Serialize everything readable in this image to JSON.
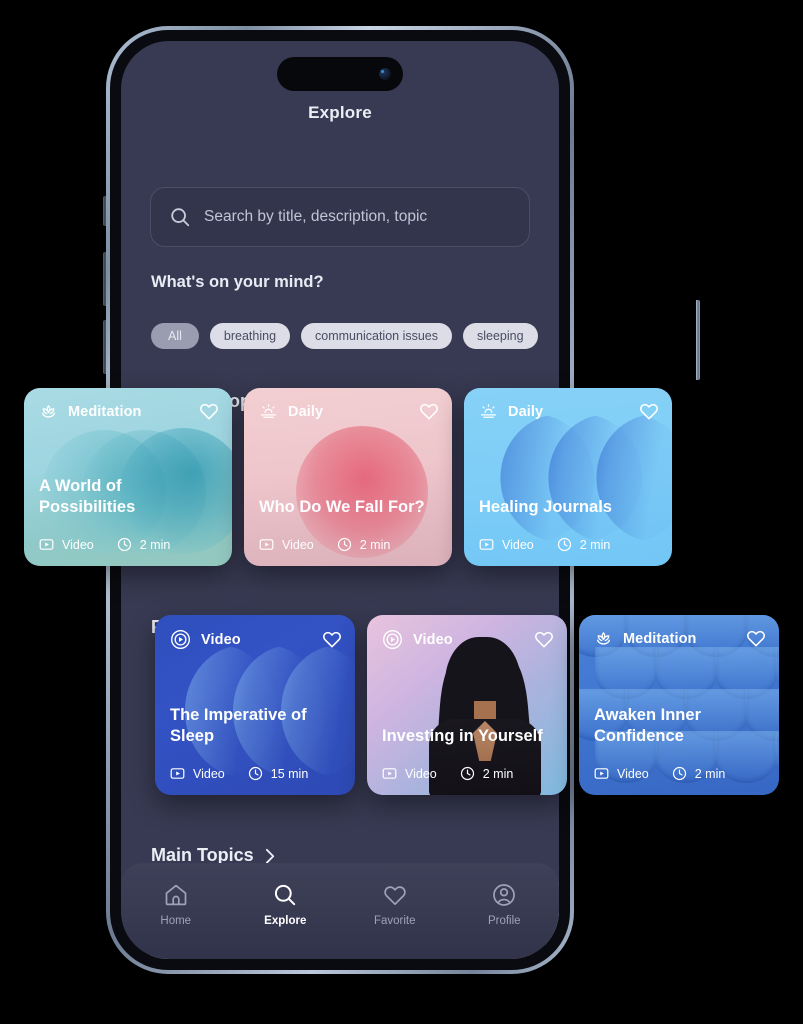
{
  "app": {
    "title": "Explore"
  },
  "search": {
    "placeholder": "Search by title, description, topic",
    "value": "",
    "icon": "search-icon"
  },
  "filters": {
    "label": "What's on your mind?",
    "chips": [
      {
        "label": "All",
        "selected": true
      },
      {
        "label": "breathing",
        "selected": false
      },
      {
        "label": "communication issues",
        "selected": false
      },
      {
        "label": "sleeping",
        "selected": false
      }
    ]
  },
  "sections": [
    {
      "id": "latest",
      "title": "Latest Drops",
      "chevron": "chevron-right-icon"
    },
    {
      "id": "popular",
      "title": "Popular Now",
      "chevron": "chevron-right-icon"
    },
    {
      "id": "topics",
      "title": "Main Topics",
      "chevron": "chevron-right-icon"
    }
  ],
  "latest_drops": [
    {
      "category": "Meditation",
      "category_icon": "lotus-icon",
      "title": "A World of Possibilities",
      "media_type": "Video",
      "duration": "2 min",
      "favorite_icon": "heart-icon",
      "media_icon": "video-icon",
      "duration_icon": "clock-icon",
      "accent": "#8fc9c9"
    },
    {
      "category": "Daily",
      "category_icon": "sunrise-icon",
      "title": "Who Do We Fall For?",
      "media_type": "Video",
      "duration": "2 min",
      "favorite_icon": "heart-icon",
      "media_icon": "video-icon",
      "duration_icon": "clock-icon",
      "accent": "#e2465f"
    },
    {
      "category": "Daily",
      "category_icon": "sunrise-icon",
      "title": "Healing Journals",
      "media_type": "Video",
      "duration": "2 min",
      "favorite_icon": "heart-icon",
      "media_icon": "video-icon",
      "duration_icon": "clock-icon",
      "accent": "#7dcdf7"
    }
  ],
  "popular_now": [
    {
      "category": "Video",
      "category_icon": "play-circle-icon",
      "title": "The Imperative of Sleep",
      "media_type": "Video",
      "duration": "15 min",
      "favorite_icon": "heart-icon",
      "media_icon": "video-icon",
      "duration_icon": "clock-icon",
      "accent": "#3352c4"
    },
    {
      "category": "Video",
      "category_icon": "play-circle-icon",
      "title": "Investing in Yourself",
      "media_type": "Video",
      "duration": "2 min",
      "favorite_icon": "heart-icon",
      "media_icon": "video-icon",
      "duration_icon": "clock-icon",
      "accent": "#a9b3dd"
    },
    {
      "category": "Meditation",
      "category_icon": "lotus-icon",
      "title": "Awaken Inner Confidence",
      "media_type": "Video",
      "duration": "2 min",
      "favorite_icon": "heart-icon",
      "media_icon": "video-icon",
      "duration_icon": "clock-icon",
      "accent": "#3f76d0"
    }
  ],
  "nav": {
    "items": [
      {
        "label": "Home",
        "icon": "home-icon",
        "active": false
      },
      {
        "label": "Explore",
        "icon": "search-icon",
        "active": true
      },
      {
        "label": "Favorite",
        "icon": "heart-icon",
        "active": false
      },
      {
        "label": "Profile",
        "icon": "profile-icon",
        "active": false
      }
    ]
  },
  "colors": {
    "screen_background": "#383a53",
    "search_field": "#32354c",
    "nav_background": "#3a3c54",
    "text_primary": "#eceef6",
    "chip_default": "#dcdde6",
    "chip_selected": "#9a9cb0"
  }
}
